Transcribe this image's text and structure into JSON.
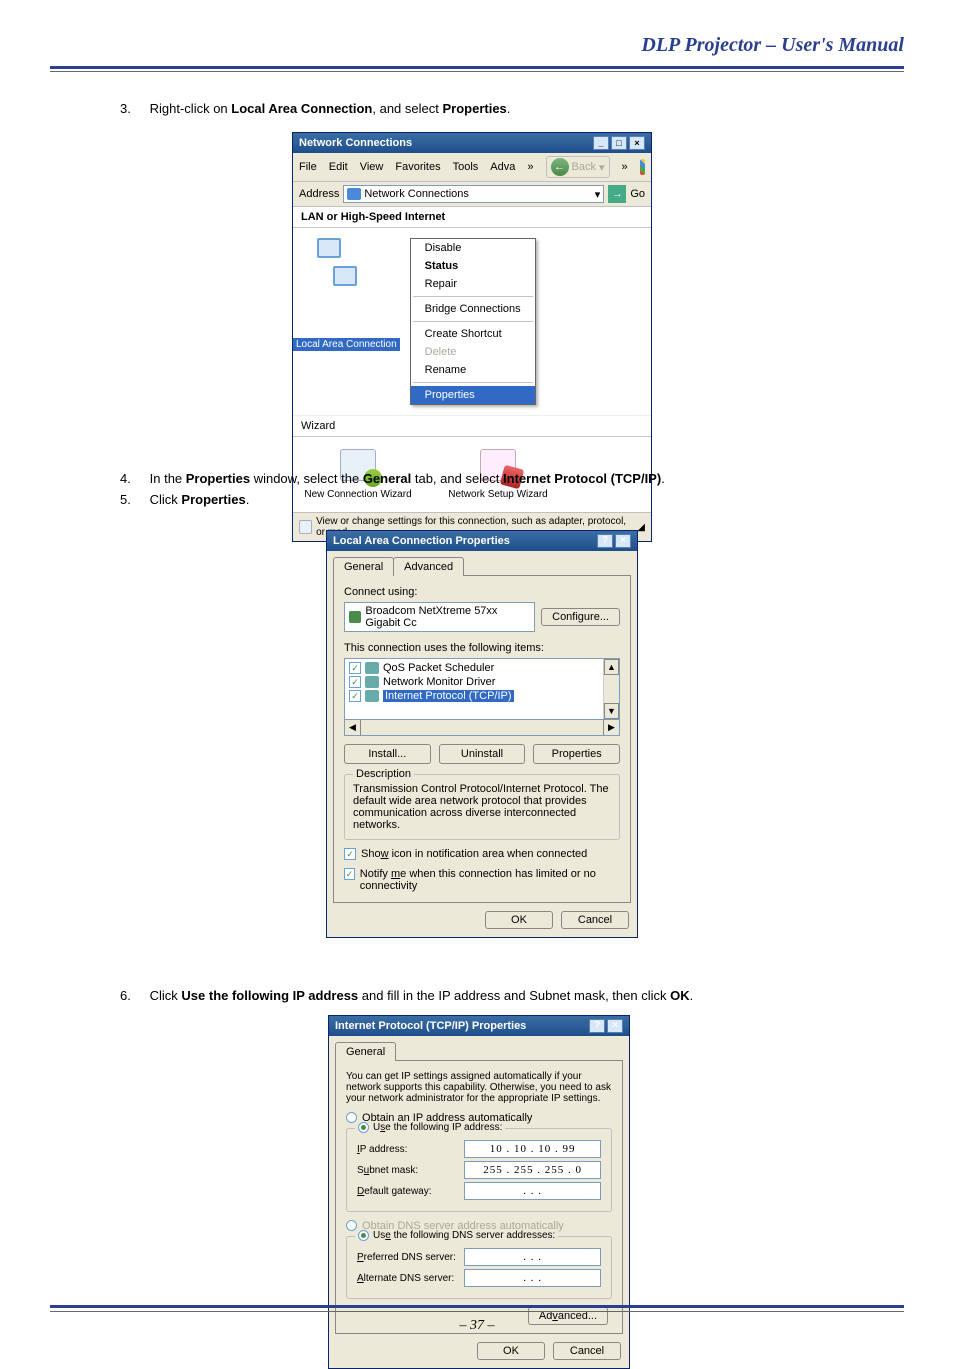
{
  "header": {
    "title": "DLP Projector – User's Manual"
  },
  "footer": {
    "page": "– 37 –"
  },
  "steps": {
    "s3": {
      "num": "3.",
      "pre": "Right-click on ",
      "b1": "Local Area Connection",
      "mid": ", and select ",
      "b2": "Properties",
      "post": "."
    },
    "s4": {
      "num": "4.",
      "pre": "In the ",
      "b1": "Properties",
      "mid1": " window, select the ",
      "b2": "General",
      "mid2": " tab, and select ",
      "b3": "Internet Protocol (TCP/IP)",
      "post": "."
    },
    "s5": {
      "num": "5.",
      "pre": "Click ",
      "b1": "Properties",
      "post": "."
    },
    "s6": {
      "num": "6.",
      "pre": "Click ",
      "b1": "Use the following IP address",
      "mid": " and fill in the IP address and Subnet mask, then click ",
      "b2": "OK",
      "post": "."
    }
  },
  "win1": {
    "title": "Network Connections",
    "menu": {
      "file": "File",
      "edit": "Edit",
      "view": "View",
      "fav": "Favorites",
      "tools": "Tools",
      "adv": "Adva"
    },
    "back": "Back",
    "addr_label": "Address",
    "addr_value": "Network Connections",
    "go": "Go",
    "cat1": "LAN or High-Speed Internet",
    "lac_label": "Local Area Connection",
    "ctx": {
      "disable": "Disable",
      "status": "Status",
      "repair": "Repair",
      "bridge": "Bridge Connections",
      "shortcut": "Create Shortcut",
      "delete": "Delete",
      "rename": "Rename",
      "properties": "Properties"
    },
    "cat2": "Wizard",
    "wiz1": "New Connection Wizard",
    "wiz2": "Network Setup Wizard",
    "status": "View or change settings for this connection, such as adapter, protocol, or mod"
  },
  "win2": {
    "title": "Local Area Connection Properties",
    "tab_general": "General",
    "tab_advanced": "Advanced",
    "connect_using": "Connect using:",
    "adapter": "Broadcom NetXtreme 57xx Gigabit Cc",
    "configure": "Configure...",
    "uses": "This connection uses the following items:",
    "items": {
      "qos": "QoS Packet Scheduler",
      "nmd": "Network Monitor Driver",
      "tcpip": "Internet Protocol (TCP/IP)"
    },
    "install": "Install...",
    "uninstall": "Uninstall",
    "properties": "Properties",
    "desc_label": "Description",
    "desc": "Transmission Control Protocol/Internet Protocol. The default wide area network protocol that provides communication across diverse interconnected networks.",
    "chk1": "Show icon in notification area when connected",
    "chk2": "Notify me when this connection has limited or no connectivity",
    "ok": "OK",
    "cancel": "Cancel"
  },
  "win3": {
    "title": "Internet Protocol (TCP/IP) Properties",
    "tab": "General",
    "intro": "You can get IP settings assigned automatically if your network supports this capability. Otherwise, you need to ask your network administrator for the appropriate IP settings.",
    "r1": "Obtain an IP address automatically",
    "r2": "Use the following IP address:",
    "ip_label": "IP address:",
    "ip_value": "10 . 10 . 10 . 99",
    "mask_label": "Subnet mask:",
    "mask_value": "255 . 255 . 255 . 0",
    "gw_label": "Default gateway:",
    "gw_value": ".       .       .",
    "r3": "Obtain DNS server address automatically",
    "r4": "Use the following DNS server addresses:",
    "pdns_label": "Preferred DNS server:",
    "pdns_value": ".       .       .",
    "adns_label": "Alternate DNS server:",
    "adns_value": ".       .       .",
    "advanced": "Advanced...",
    "ok": "OK",
    "cancel": "Cancel"
  }
}
